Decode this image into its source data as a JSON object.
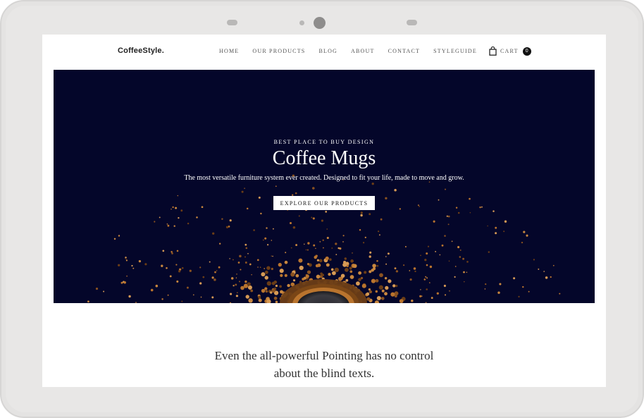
{
  "header": {
    "logo": "CoffeeStyle.",
    "menu": [
      {
        "label": "HOME"
      },
      {
        "label": "OUR PRODUCTS"
      },
      {
        "label": "BLOG"
      },
      {
        "label": "ABOUT"
      },
      {
        "label": "CONTACT"
      },
      {
        "label": "STYLEGUIDE"
      }
    ],
    "cart": {
      "label": "CART",
      "count": "0",
      "icon": "shopping-bag-icon"
    }
  },
  "hero": {
    "kicker": "BEST PLACE TO BUY DESIGN",
    "title": "Coffee Mugs",
    "subtitle": "The most versatile furniture system ever created. Designed to fit your life, made to move and grow.",
    "button_label": "EXPLORE OUR PRODUCTS",
    "background_color": "#04062a",
    "accent_color": "#b87a3c"
  },
  "intro": {
    "line1": "Even the all-powerful Pointing has no control",
    "line2": "about the blind texts."
  }
}
